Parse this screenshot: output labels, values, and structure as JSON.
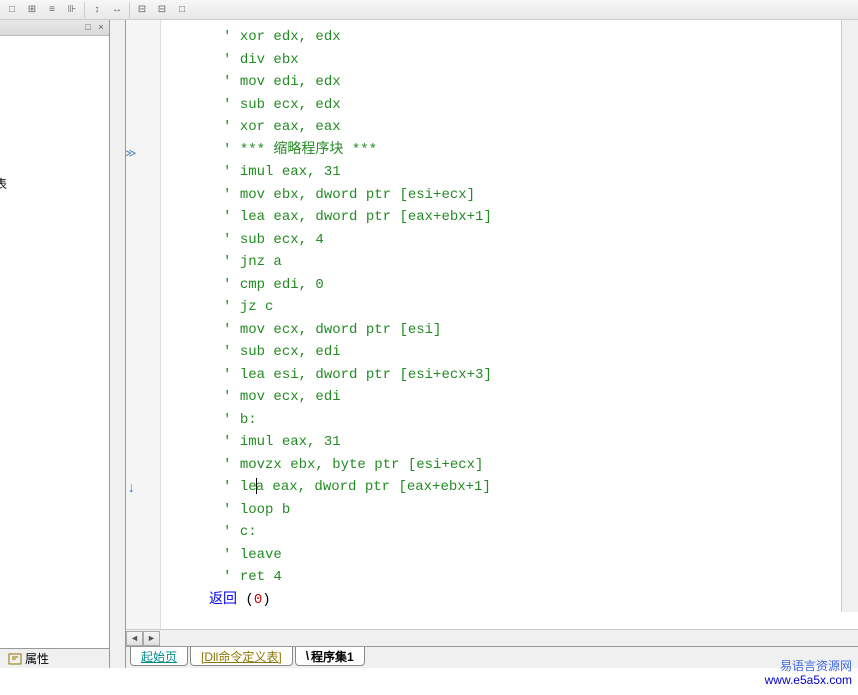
{
  "toolbar": {
    "buttons": [
      "□",
      "⊞",
      "≡",
      "⊪",
      "↕",
      "↔",
      "⊟",
      "⊟",
      "□"
    ]
  },
  "left_panel": {
    "clipped_label": "表",
    "close_label": "×",
    "pin_label": "□",
    "properties_tab": "属性"
  },
  "code": {
    "lines": [
      {
        "q": "'",
        "t": "xor edx, edx"
      },
      {
        "q": "'",
        "t": "div ebx"
      },
      {
        "q": "'",
        "t": "mov edi, edx"
      },
      {
        "q": "'",
        "t": "sub ecx, edx"
      },
      {
        "q": "'",
        "t": "xor eax, eax"
      },
      {
        "q": "'",
        "t": "*** 缩略程序块 ***",
        "collapse": true
      },
      {
        "q": "'",
        "t": "imul eax, 31"
      },
      {
        "q": "'",
        "t": "mov ebx, dword ptr [esi+ecx]"
      },
      {
        "q": "'",
        "t": "lea eax, dword ptr [eax+ebx+1]"
      },
      {
        "q": "'",
        "t": "sub ecx, 4"
      },
      {
        "q": "'",
        "t": "jnz a"
      },
      {
        "q": "'",
        "t": "cmp edi, 0"
      },
      {
        "q": "'",
        "t": "jz c"
      },
      {
        "q": "'",
        "t": "mov ecx, dword ptr [esi]"
      },
      {
        "q": "'",
        "t": "sub ecx, edi"
      },
      {
        "q": "'",
        "t": "lea esi, dword ptr [esi+ecx+3]"
      },
      {
        "q": "'",
        "t": "mov ecx, edi"
      },
      {
        "q": "'",
        "t": "b:"
      },
      {
        "q": "'",
        "t": "imul eax, 31"
      },
      {
        "q": "'",
        "t": "movzx ebx, byte ptr [esi+ecx]"
      },
      {
        "q": "'",
        "t": "lea eax, dword ptr [eax+ebx+1]",
        "cursor": 2,
        "arrow_down": true
      },
      {
        "q": "'",
        "t": "loop b"
      },
      {
        "q": "'",
        "t": "c:"
      },
      {
        "q": "'",
        "t": "leave"
      },
      {
        "q": "'",
        "t": "ret 4"
      }
    ],
    "return_kw": "返回",
    "return_val": "0"
  },
  "tabs": {
    "t1": "起始页",
    "t2": "[Dll命令定义表]",
    "t3": "程序集1"
  },
  "watermark": {
    "line1": "易语言资源网",
    "line2": "www.e5a5x.com"
  }
}
